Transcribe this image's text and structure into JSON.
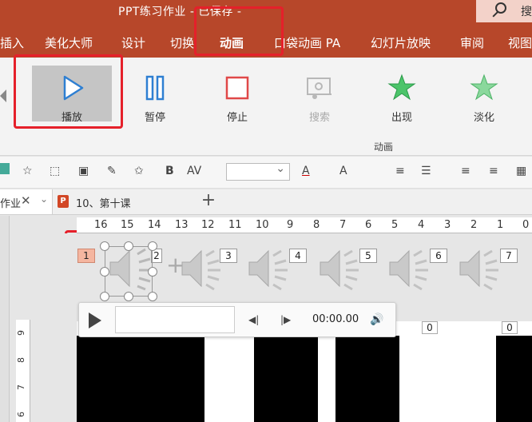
{
  "titlebar": {
    "title": "PPT练习作业 - 已保存 -",
    "search_label": "搜"
  },
  "tabs": [
    {
      "label": "插入"
    },
    {
      "label": "美化大师"
    },
    {
      "label": "设计"
    },
    {
      "label": "切换"
    },
    {
      "label": "动画",
      "active": true
    },
    {
      "label": "口袋动画 PA"
    },
    {
      "label": "幻灯片放映"
    },
    {
      "label": "审阅"
    },
    {
      "label": "视图"
    }
  ],
  "ribbon": {
    "buttons": [
      {
        "label": "播放",
        "icon": "play-icon",
        "selected": true
      },
      {
        "label": "暂停",
        "icon": "pause-icon"
      },
      {
        "label": "停止",
        "icon": "stop-icon"
      },
      {
        "label": "搜索",
        "icon": "seek-icon",
        "disabled": true
      },
      {
        "label": "出现",
        "icon": "star-appear-icon"
      },
      {
        "label": "淡化",
        "icon": "star-fade-icon"
      }
    ],
    "group_label": "动画"
  },
  "toolbar": {
    "bold": "B",
    "spacing": "AV",
    "font_color": "A",
    "grow_font": "A"
  },
  "doctabs": {
    "tab1_label": "作业",
    "tab2_label": "10、第十课",
    "ppt_icon_label": "P"
  },
  "ruler": {
    "top_numbers": [
      "16",
      "15",
      "14",
      "13",
      "12",
      "11",
      "10",
      "9",
      "8",
      "7",
      "6",
      "5",
      "4",
      "3",
      "2",
      "1",
      "0"
    ],
    "left_numbers": [
      "9",
      "8",
      "7",
      "6"
    ]
  },
  "sounds": [
    {
      "number": "1"
    },
    {
      "number": "2"
    },
    {
      "number": "3"
    },
    {
      "number": "4"
    },
    {
      "number": "5"
    },
    {
      "number": "6"
    },
    {
      "number": "7"
    }
  ],
  "player": {
    "time": "00:00.00"
  },
  "counters": [
    "0",
    "0"
  ],
  "colors": {
    "brand": "#b7472a",
    "highlight": "#e5202a"
  }
}
